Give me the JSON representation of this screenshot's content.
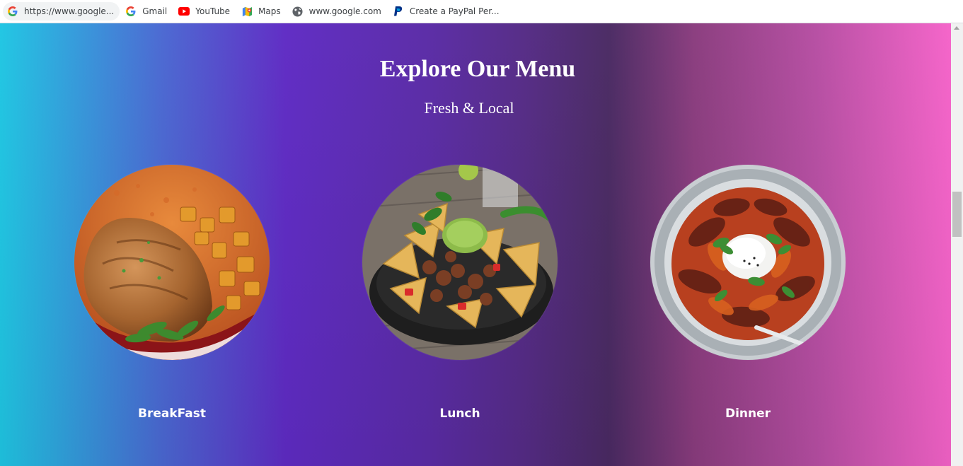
{
  "bookmarks": [
    {
      "label": "https://www.google...",
      "icon": "google-icon"
    },
    {
      "label": "Gmail",
      "icon": "google-icon"
    },
    {
      "label": "YouTube",
      "icon": "youtube-icon"
    },
    {
      "label": "Maps",
      "icon": "maps-icon"
    },
    {
      "label": "www.google.com",
      "icon": "globe-icon"
    },
    {
      "label": "Create a PayPal Per...",
      "icon": "paypal-icon"
    }
  ],
  "menu": {
    "title": "Explore Our Menu",
    "subtitle": "Fresh & Local",
    "dishes": [
      {
        "label": "BreakFast",
        "image": "breakfast-photo"
      },
      {
        "label": "Lunch",
        "image": "lunch-photo"
      },
      {
        "label": "Dinner",
        "image": "dinner-photo"
      }
    ]
  },
  "colors": {
    "gradient_left": "#1fc6e3",
    "gradient_mid": "#5f2bc4",
    "gradient_dark": "#4a2a63",
    "gradient_right": "#f563c9",
    "text": "#ffffff"
  }
}
